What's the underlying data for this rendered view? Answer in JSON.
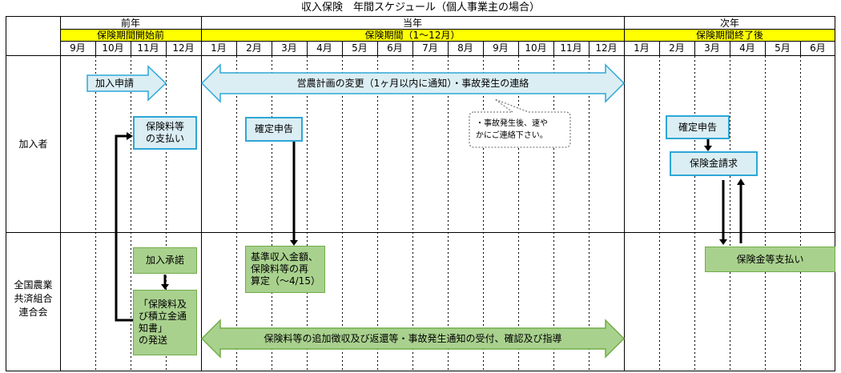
{
  "title": "収入保険　年間スケジュール（個人事業主の場合）",
  "years": [
    {
      "label": "前年",
      "period": "保険期間開始前"
    },
    {
      "label": "当年",
      "period": "保険期間（1～12月）"
    },
    {
      "label": "次年",
      "period": "保険期間終了後"
    }
  ],
  "months": [
    "9月",
    "10月",
    "11月",
    "12月",
    "1月",
    "2月",
    "3月",
    "4月",
    "5月",
    "6月",
    "7月",
    "8月",
    "9月",
    "10月",
    "11月",
    "12月",
    "1月",
    "2月",
    "3月",
    "4月",
    "5月",
    "6月"
  ],
  "rows": {
    "member": "加入者",
    "federation": "全国農業\n共済組合\n連合会"
  },
  "member_items": {
    "apply": "加入申請",
    "premium_payment": "保険料等\nの支払い",
    "plan_change": "営農計画の変更（1ヶ月以内に通知）・事故発生の連絡",
    "callout": "・事故発生後、速や\nかにご連絡下さい。",
    "tax_return_current": "確定申告",
    "tax_return_next": "確定申告",
    "claim": "保険金請求"
  },
  "federation_items": {
    "approval": "加入承諾",
    "recalc": "基準収入金額、\n保険料等の再\n算定（～4/15）",
    "notice": "「保険料及\nび積立金通\n知書」\nの発送",
    "guidance": "保険料等の追加徴収及び返還等・事故発生通知の受付、確認及び指導",
    "payout": "保険金等支払い"
  },
  "colors": {
    "period_band": "#ffff00",
    "blue_fill": "#dbeef4",
    "blue_border": "#2ea7d6",
    "green_fill": "#a9d18e",
    "green_border": "#70ad47"
  }
}
